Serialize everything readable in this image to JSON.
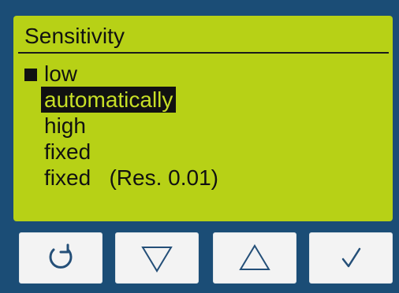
{
  "screen": {
    "title": "Sensitivity",
    "items": [
      {
        "label": "low",
        "active_marker": true,
        "selected": false
      },
      {
        "label": "automatically",
        "active_marker": false,
        "selected": true
      },
      {
        "label": "high",
        "active_marker": false,
        "selected": false
      },
      {
        "label": "fixed",
        "active_marker": false,
        "selected": false
      },
      {
        "label": "fixed   (Res. 0.01)",
        "active_marker": false,
        "selected": false
      }
    ]
  },
  "buttons": [
    {
      "icon": "rotate-ccw-icon"
    },
    {
      "icon": "triangle-down-icon"
    },
    {
      "icon": "triangle-up-icon"
    },
    {
      "icon": "checkmark-icon"
    }
  ],
  "colors": {
    "device_bg": "#1b4d76",
    "screen_bg": "#b7d116",
    "text": "#111111",
    "highlight_text": "#c7df26",
    "button_bg": "#f3f3f3",
    "icon_stroke": "#244f78"
  }
}
